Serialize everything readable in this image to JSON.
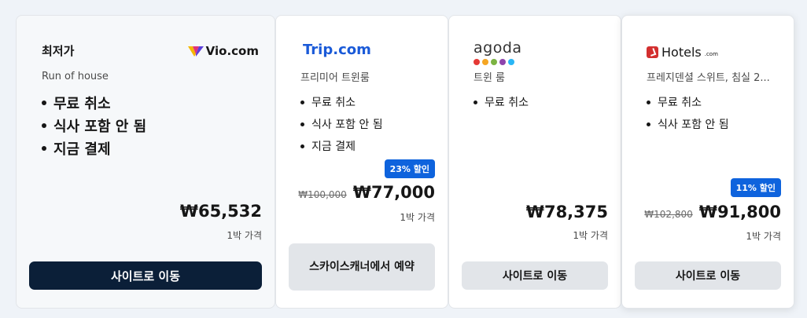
{
  "cards": [
    {
      "header_label": "최저가",
      "provider_logo": "Vio.com",
      "room": "Run of house",
      "features": [
        "무료 취소",
        "식사 포함 안 됨",
        "지금 결제"
      ],
      "price": "₩65,532",
      "per_night": "1박 가격",
      "cta": "사이트로 이동"
    },
    {
      "provider_logo": "Trip.com",
      "room": "프리미어 트윈룸",
      "features": [
        "무료 취소",
        "식사 포함 안 됨",
        "지금 결제"
      ],
      "discount_badge": "23% 할인",
      "original_price": "₩100,000",
      "price": "₩77,000",
      "per_night": "1박 가격",
      "cta": "스카이스캐너에서 예약"
    },
    {
      "provider_logo": "agoda",
      "logo_dot_colors": [
        "#e53935",
        "#f5a623",
        "#7cb342",
        "#8e44ad",
        "#29b6f6"
      ],
      "room": "트윈 룸",
      "features": [
        "무료 취소"
      ],
      "price": "₩78,375",
      "per_night": "1박 가격",
      "cta": "사이트로 이동"
    },
    {
      "provider_logo": "Hotels",
      "provider_logo_suffix": ".com",
      "room": "프레지덴셜 스위트, 침실 2...",
      "features": [
        "무료 취소",
        "식사 포함 안 됨"
      ],
      "discount_badge": "11% 할인",
      "original_price": "₩102,800",
      "price": "₩91,800",
      "per_night": "1박 가격",
      "cta": "사이트로 이동"
    }
  ],
  "colors": {
    "primary_cta": "#0b1f38",
    "secondary_cta": "#e2e5e9",
    "badge": "#0e63dd",
    "trip_brand": "#1a5ad8",
    "hotels_brand": "#d32f2f"
  }
}
